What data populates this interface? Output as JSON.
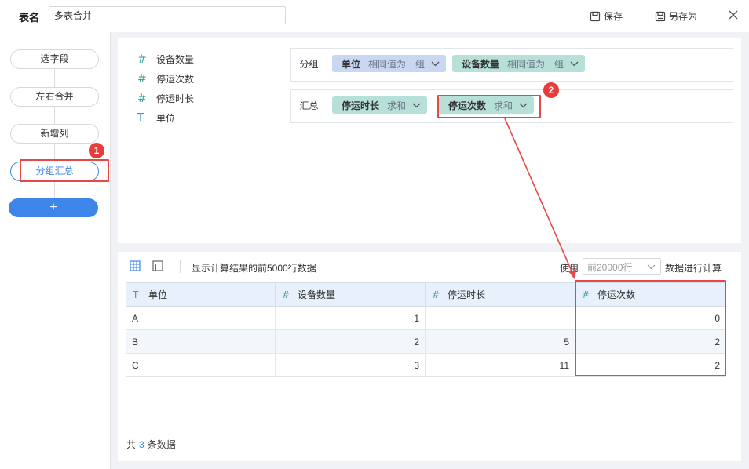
{
  "header": {
    "table_name_label": "表名",
    "table_name_value": "多表合并",
    "save_label": "保存",
    "save_as_label": "另存为"
  },
  "sidebar": {
    "steps": [
      {
        "label": "选字段"
      },
      {
        "label": "左右合并"
      },
      {
        "label": "新增列"
      },
      {
        "label": "分组汇总"
      }
    ],
    "add_label": "+"
  },
  "fields": [
    {
      "icon": "#",
      "name": "设备数量"
    },
    {
      "icon": "#",
      "name": "停运次数"
    },
    {
      "icon": "#",
      "name": "停运时长"
    },
    {
      "icon": "T",
      "name": "单位"
    }
  ],
  "group_row": {
    "label": "分组",
    "chips": [
      {
        "name": "单位",
        "agg": "相同值为一组",
        "color": "#c9d7f2"
      },
      {
        "name": "设备数量",
        "agg": "相同值为一组",
        "color": "#b7e0d9"
      }
    ]
  },
  "summary_row": {
    "label": "汇总",
    "chips": [
      {
        "name": "停运时长",
        "agg": "求和",
        "color": "#b7e0d9"
      },
      {
        "name": "停运次数",
        "agg": "求和",
        "color": "#b7e0d9"
      }
    ]
  },
  "results": {
    "note": "显示计算结果的前5000行数据",
    "use_label": "使用",
    "use_value": "前20000行",
    "calc_label": "数据进行计算",
    "columns": [
      {
        "icon": "T",
        "name": "单位"
      },
      {
        "icon": "#",
        "name": "设备数量"
      },
      {
        "icon": "#",
        "name": "停运时长"
      },
      {
        "icon": "#",
        "name": "停运次数"
      }
    ],
    "rows": [
      [
        "A",
        "1",
        "",
        "0"
      ],
      [
        "B",
        "2",
        "5",
        "2"
      ],
      [
        "C",
        "3",
        "11",
        "2"
      ]
    ],
    "total_prefix": "共",
    "total_count": "3",
    "total_suffix": "条数据"
  },
  "annotations": {
    "badge1": "1",
    "badge2": "2",
    "color": "#e84747"
  }
}
